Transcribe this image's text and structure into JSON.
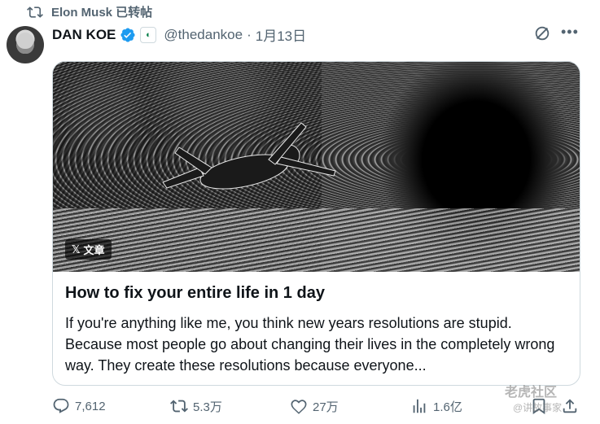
{
  "retweet": {
    "text": "Elon Musk 已转帖"
  },
  "author": {
    "name": "DAN KOE",
    "handle": "@thedankoe",
    "separator": "·",
    "date": "1月13日"
  },
  "card": {
    "badge": "文章",
    "title": "How to fix your entire life in 1 day",
    "description": "If you're anything like me, you think new years resolutions are stupid. Because most people go about changing their lives in the completely wrong way. They create these resolutions because everyone..."
  },
  "actions": {
    "replies": "7,612",
    "reposts": "5.3万",
    "likes": "27万",
    "views": "1.6亿"
  },
  "watermark": {
    "line1": "老虎社区",
    "line2": "@讲故事家"
  },
  "colors": {
    "verified": "#1d9bf0",
    "text_secondary": "#536471",
    "border": "#cfd9de"
  }
}
